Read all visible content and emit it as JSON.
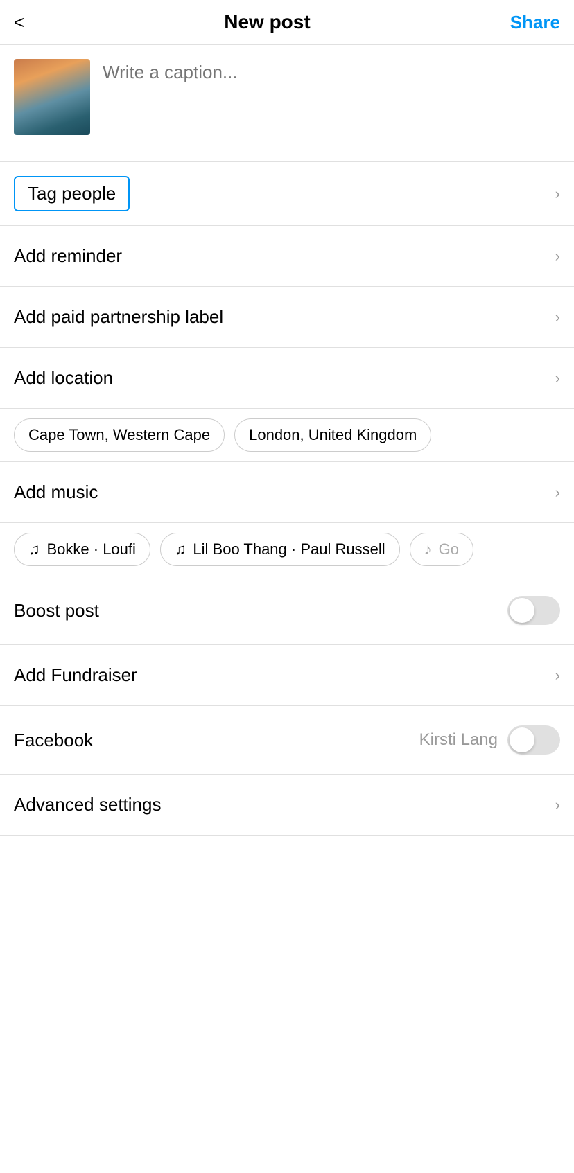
{
  "header": {
    "back_icon": "‹",
    "title": "New post",
    "share_label": "Share"
  },
  "caption": {
    "placeholder": "Write a caption..."
  },
  "tag_people": {
    "label": "Tag people"
  },
  "menu_items": [
    {
      "id": "add-reminder",
      "label": "Add reminder"
    },
    {
      "id": "add-paid-partnership",
      "label": "Add paid partnership label"
    },
    {
      "id": "add-location",
      "label": "Add location"
    }
  ],
  "location_chips": [
    {
      "id": "cape-town",
      "label": "Cape Town, Western Cape"
    },
    {
      "id": "london",
      "label": "London, United Kingdom"
    }
  ],
  "add_music": {
    "label": "Add music"
  },
  "music_chips": [
    {
      "id": "bokke-loufi",
      "note": "♫",
      "label": "Bokke · Loufi"
    },
    {
      "id": "lil-boo-thang",
      "note": "♫",
      "label": "Lil Boo Thang · Paul Russell"
    },
    {
      "id": "more",
      "note": "♪",
      "label": "Go..."
    }
  ],
  "boost_post": {
    "label": "Boost post",
    "enabled": false
  },
  "add_fundraiser": {
    "label": "Add Fundraiser"
  },
  "facebook": {
    "label": "Facebook",
    "username": "Kirsti Lang",
    "enabled": false
  },
  "advanced_settings": {
    "label": "Advanced settings"
  },
  "icons": {
    "chevron": "›",
    "back": "<"
  }
}
